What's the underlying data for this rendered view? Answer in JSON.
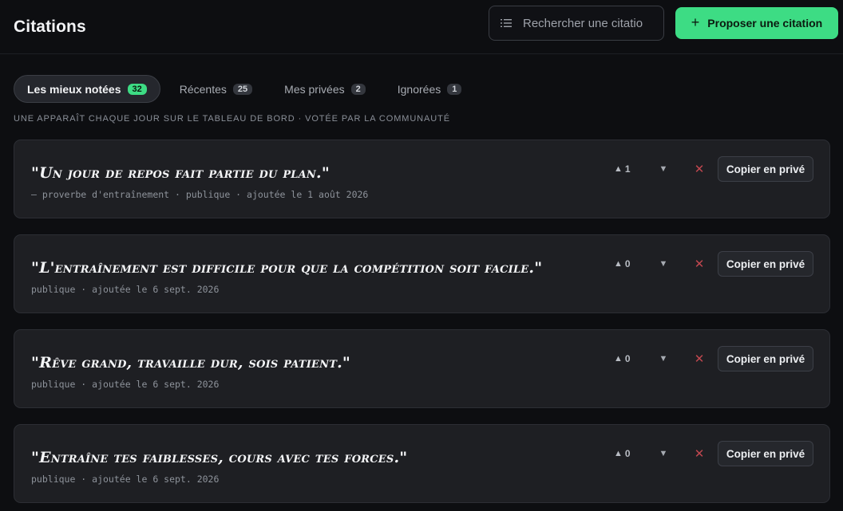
{
  "header": {
    "title": "Citations",
    "search_placeholder": "Rechercher une citation",
    "propose_label": "Proposer une citation"
  },
  "tabs": [
    {
      "label": "Les mieux notées",
      "count": "32",
      "active": true
    },
    {
      "label": "Récentes",
      "count": "25",
      "active": false
    },
    {
      "label": "Mes privées",
      "count": "2",
      "active": false
    },
    {
      "label": "Ignorées",
      "count": "1",
      "active": false
    }
  ],
  "subtitle": "UNE APPARAÎT CHAQUE JOUR SUR LE TABLEAU DE BORD · VOTÉE PAR LA COMMUNAUTÉ",
  "quotes": [
    {
      "text": "\"Un jour de repos fait partie du plan.\"",
      "meta": "— proverbe d'entraînement · publique · ajoutée le 1 août 2026",
      "votes": "1"
    },
    {
      "text": "\"L'entraînement est difficile pour que la compétition soit facile.\"",
      "meta": "publique · ajoutée le 6 sept. 2026",
      "votes": "0"
    },
    {
      "text": "\"Rêve grand, travaille dur, sois patient.\"",
      "meta": "publique · ajoutée le 6 sept. 2026",
      "votes": "0"
    },
    {
      "text": "\"Entraîne tes faiblesses, cours avec tes forces.\"",
      "meta": "publique · ajoutée le 6 sept. 2026",
      "votes": "0"
    }
  ],
  "actions": {
    "upvote_icon": "▲",
    "downvote_icon": "▼",
    "dismiss_icon": "✕",
    "copy_label": "Copier en privé"
  },
  "colors": {
    "accent": "#3ddc84",
    "danger": "#c0474f",
    "background": "#0d0e11",
    "card": "#1e1f23"
  }
}
